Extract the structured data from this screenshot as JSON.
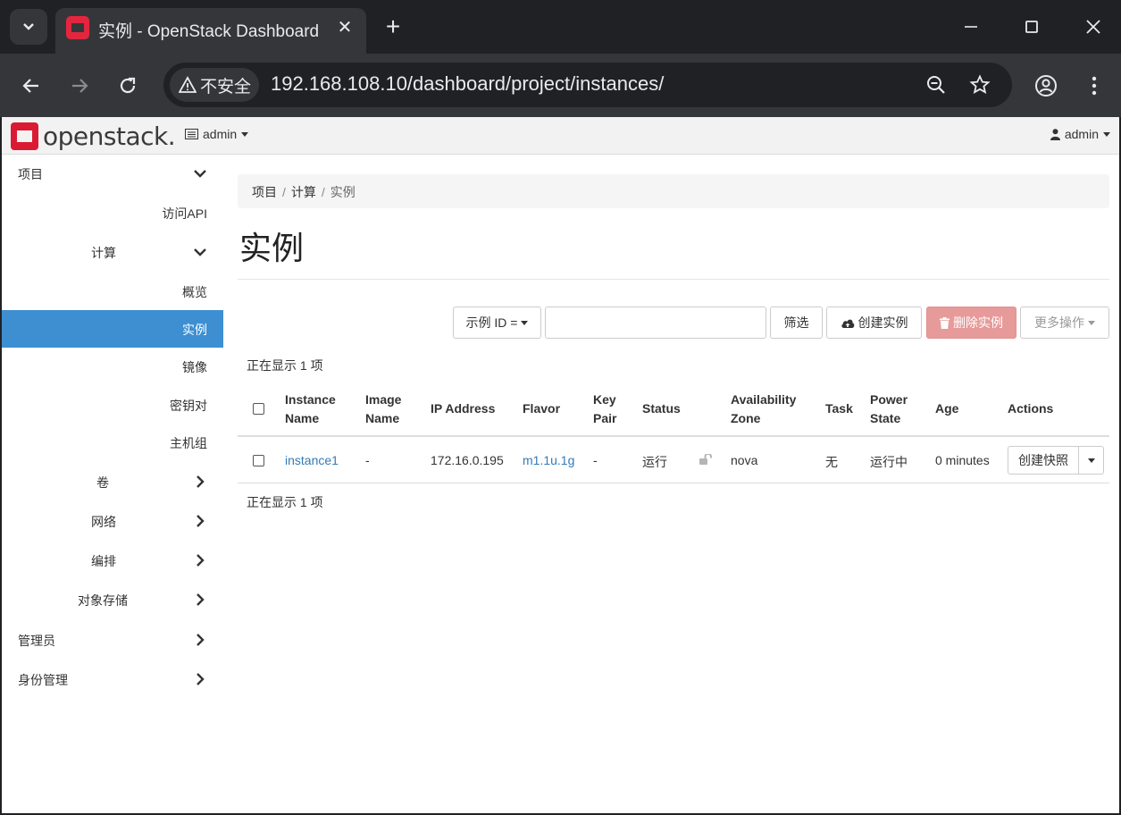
{
  "browser": {
    "tab_title": "实例 - OpenStack Dashboard",
    "security_label": "不安全",
    "url": "192.168.108.10/dashboard/project/instances/"
  },
  "navbar": {
    "logo_text": "openstack.",
    "project": "admin",
    "user": "admin"
  },
  "sidebar": {
    "project": "项目",
    "api_access": "访问API",
    "compute": "计算",
    "overview": "概览",
    "instances": "实例",
    "images": "镜像",
    "key_pairs": "密钥对",
    "server_groups": "主机组",
    "volumes": "卷",
    "network": "网络",
    "orchestration": "编排",
    "object_store": "对象存储",
    "admin": "管理员",
    "identity": "身份管理"
  },
  "breadcrumb": [
    "项目",
    "计算",
    "实例"
  ],
  "page_title": "实例",
  "toolbar": {
    "filter_field": "示例 ID =",
    "filter_value": "",
    "filter_button": "筛选",
    "launch_button": "创建实例",
    "delete_button": "删除实例",
    "more_actions": "更多操作"
  },
  "count_text": "正在显示 1 项",
  "table": {
    "headers": {
      "name_1": "Instance",
      "name_2": "Name",
      "image_1": "Image",
      "image_2": "Name",
      "ip": "IP Address",
      "flavor": "Flavor",
      "key_1": "Key",
      "key_2": "Pair",
      "status": "Status",
      "az_1": "Availability",
      "az_2": "Zone",
      "task": "Task",
      "power_1": "Power",
      "power_2": "State",
      "age": "Age",
      "actions": "Actions"
    },
    "rows": [
      {
        "name": "instance1",
        "image": "-",
        "ip": "172.16.0.195",
        "flavor": "m1.1u.1g",
        "key_pair": "-",
        "status": "运行",
        "az": "nova",
        "task": "无",
        "power": "运行中",
        "age": "0 minutes",
        "action": "创建快照"
      }
    ]
  },
  "colors": {
    "active_nav": "#3d8fd1",
    "link": "#337ab7",
    "danger_button": "#e79a9a",
    "brand_red": "#da1a32"
  }
}
